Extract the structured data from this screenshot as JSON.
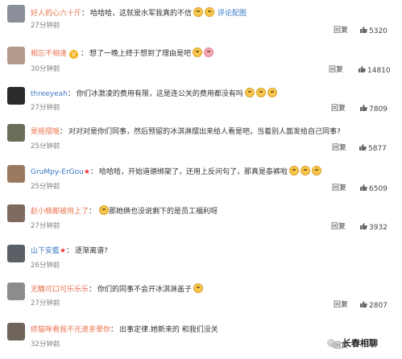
{
  "comments": [
    {
      "user": "好人的心六十斤",
      "content": "哈哈哈，这就是水军我真的不信",
      "emojis": 2,
      "link": "评论配图",
      "time": "27分钟前",
      "reply": "回复",
      "likes": "5320",
      "avatar_color": "#8a8f99"
    },
    {
      "user": "相忘不相逢",
      "vip": "V",
      "content": "想了一晚上终于想到了理由是吧",
      "emojis": 1,
      "pig": true,
      "time": "30分钟前",
      "reply": "回复",
      "likes": "14810",
      "avatar_color": "#b49a8a"
    },
    {
      "user": "threeyeah",
      "content": "你们冰激凌的费用有限，这是连公关的费用都没有吗",
      "emojis": 3,
      "time": "27分钟前",
      "reply": "回复",
      "likes": "7809",
      "avatar_color": "#2b2b2b"
    },
    {
      "user": "是摇摆哦",
      "content": "对对对是你们同事，然后预留的冰淇淋摆出来给人看是吧，当着别人面发给自己同事?",
      "emojis": 0,
      "time": "25分钟前",
      "reply": "回复",
      "likes": "5877",
      "avatar_color": "#6b6f5a"
    },
    {
      "user": "GruMpy-ErGou",
      "star": "★",
      "content": "哈哈哈，开始道德绑架了，还用上反问句了，那真是泰裤啦",
      "emojis": 3,
      "time": "25分钟前",
      "reply": "回复",
      "likes": "6509",
      "avatar_color": "#9a7b60"
    },
    {
      "user": "赵小楠都被用上了",
      "content": "那她俩也没说剩下的是员工福利呀",
      "emoji_first": true,
      "emojis": 1,
      "time": "27分钟前",
      "reply": "回复",
      "likes": "3932",
      "avatar_color": "#7f6a5e"
    },
    {
      "user": "山下安藍",
      "star": "★",
      "content": "逐渐离谱?",
      "emojis": 0,
      "time": "26分钟前",
      "reply": "",
      "likes": "",
      "avatar_color": "#5b5f66"
    },
    {
      "user": "无糖可口可乐乐乐",
      "content": "你们的同事不会开冰淇淋盖子",
      "emojis": 1,
      "time": "27分钟前",
      "reply": "回复",
      "likes": "2807",
      "avatar_color": "#8c8c8c"
    },
    {
      "user": "修猫咪看我不光速亲晕你",
      "content": "出事定律.她新来的 和我们没关",
      "emojis": 0,
      "time": "32分钟前",
      "reply": "回复",
      "likes": "",
      "avatar_color": "#6e6459"
    }
  ],
  "watermark": "长春相聊",
  "colors": {
    "username": "#eb7350",
    "link": "#3b79c4",
    "time": "#808080"
  }
}
